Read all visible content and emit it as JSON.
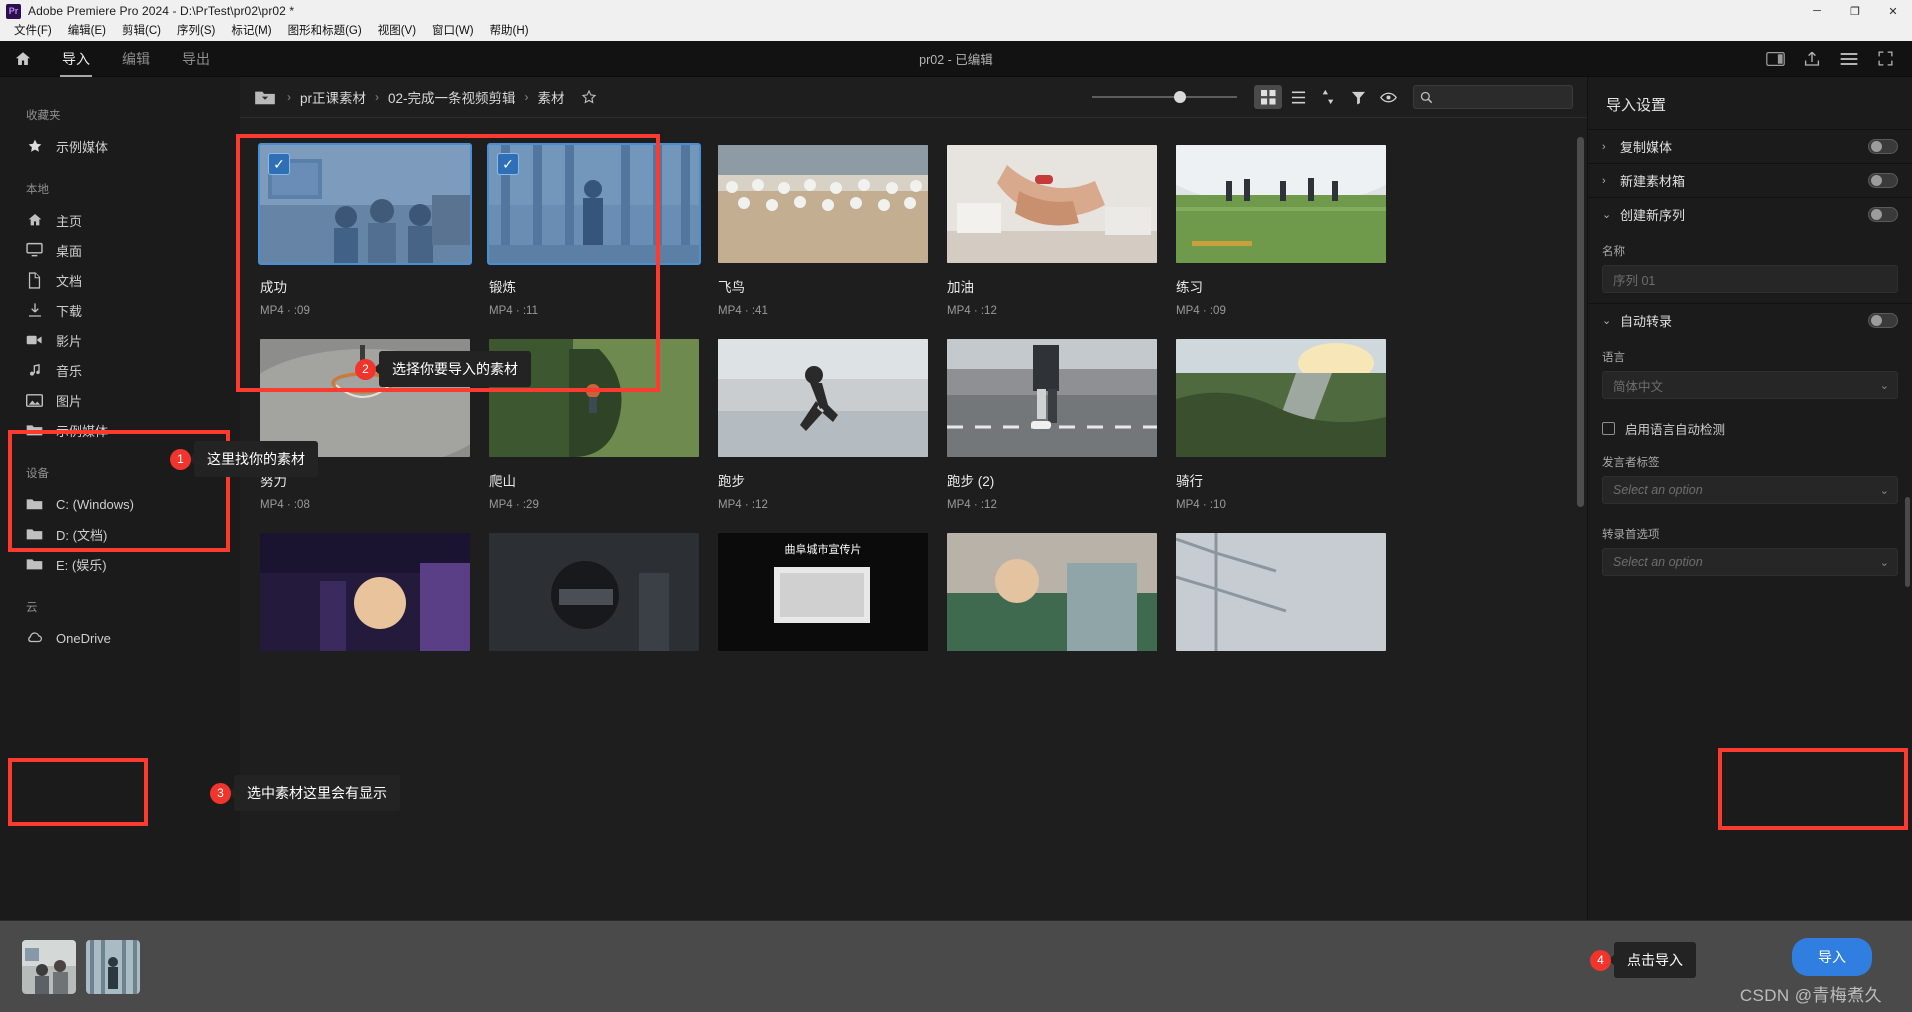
{
  "window": {
    "app_title": "Adobe Premiere Pro 2024 - D:\\PrTest\\pr02\\pr02 *",
    "logo_text": "Pr",
    "minimize": "─",
    "maximize": "❐",
    "close": "✕"
  },
  "menubar": {
    "items": [
      "文件(F)",
      "编辑(E)",
      "剪辑(C)",
      "序列(S)",
      "标记(M)",
      "图形和标题(G)",
      "视图(V)",
      "窗口(W)",
      "帮助(H)"
    ]
  },
  "workspace": {
    "home_icon": "home-icon",
    "tabs": [
      {
        "label": "导入",
        "active": true
      },
      {
        "label": "编辑",
        "active": false
      },
      {
        "label": "导出",
        "active": false
      }
    ],
    "project_title": "pr02 - 已编辑",
    "right_icons": [
      "panel-icon",
      "share-icon",
      "menu-icon",
      "fullscreen-icon"
    ]
  },
  "sidebar": {
    "groups": [
      {
        "title": "收藏夹",
        "items": [
          {
            "icon": "star-icon",
            "label": "示例媒体"
          }
        ]
      },
      {
        "title": "本地",
        "items": [
          {
            "icon": "home-icon",
            "label": "主页"
          },
          {
            "icon": "desktop-icon",
            "label": "桌面"
          },
          {
            "icon": "document-icon",
            "label": "文档"
          },
          {
            "icon": "download-icon",
            "label": "下载"
          },
          {
            "icon": "video-icon",
            "label": "影片"
          },
          {
            "icon": "music-icon",
            "label": "音乐"
          },
          {
            "icon": "image-icon",
            "label": "图片"
          },
          {
            "icon": "folder-icon",
            "label": "示例媒体"
          }
        ]
      },
      {
        "title": "设备",
        "items": [
          {
            "icon": "folder-icon",
            "label": "C: (Windows)"
          },
          {
            "icon": "folder-icon",
            "label": "D: (文档)"
          },
          {
            "icon": "folder-icon",
            "label": "E: (娱乐)"
          }
        ]
      },
      {
        "title": "云",
        "items": [
          {
            "icon": "cloud-icon",
            "label": "OneDrive"
          }
        ]
      }
    ]
  },
  "browser": {
    "breadcrumb": {
      "folder_icon": "folder-dropdown-icon",
      "parts": [
        "pr正课素材",
        "02-完成一条视频剪辑",
        "素材"
      ],
      "separator": "›",
      "star_icon": "star-outline-icon"
    },
    "toolbar": {
      "zoom_slider_value": 57,
      "grid_view_icon": "grid-view-icon",
      "list_view_icon": "list-view-icon",
      "sort_icon": "sort-icon",
      "filter_icon": "filter-icon",
      "eye_icon": "eye-icon",
      "search_icon": "search-icon",
      "search_value": "",
      "search_placeholder": ""
    },
    "items": [
      {
        "name": "成功",
        "meta": "MP4 · :09",
        "selected": true,
        "checked": true,
        "art": "office"
      },
      {
        "name": "锻炼",
        "meta": "MP4 · :11",
        "selected": true,
        "checked": true,
        "art": "hall"
      },
      {
        "name": "飞鸟",
        "meta": "MP4 · :41",
        "selected": false,
        "checked": false,
        "art": "birds"
      },
      {
        "name": "加油",
        "meta": "MP4 · :12",
        "selected": false,
        "checked": false,
        "art": "hands"
      },
      {
        "name": "练习",
        "meta": "MP4 · :09",
        "selected": false,
        "checked": false,
        "art": "field"
      },
      {
        "name": "努力",
        "meta": "MP4 · :08",
        "selected": false,
        "checked": false,
        "art": "hoop"
      },
      {
        "name": "爬山",
        "meta": "MP4 · :29",
        "selected": false,
        "checked": false,
        "art": "cliff"
      },
      {
        "name": "跑步",
        "meta": "MP4 · :12",
        "selected": false,
        "checked": false,
        "art": "runner"
      },
      {
        "name": "跑步 (2)",
        "meta": "MP4 · :12",
        "selected": false,
        "checked": false,
        "art": "prosthetic"
      },
      {
        "name": "骑行",
        "meta": "MP4 · :10",
        "selected": false,
        "checked": false,
        "art": "road"
      }
    ],
    "partial_row": [
      {
        "art": "concert"
      },
      {
        "art": "helmet"
      },
      {
        "art": "citytitle",
        "overlay_text": "曲阜城市宣传片"
      },
      {
        "art": "surgery"
      },
      {
        "art": "tower"
      }
    ]
  },
  "import_settings": {
    "title": "导入设置",
    "sections": [
      {
        "chev": "›",
        "label": "复制媒体",
        "toggle": "off"
      },
      {
        "chev": "›",
        "label": "新建素材箱",
        "toggle": "off"
      },
      {
        "chev": "⌄",
        "label": "创建新序列",
        "toggle": "off"
      }
    ],
    "sequence": {
      "name_label": "名称",
      "name_placeholder": "序列 01"
    },
    "transcription": {
      "chev": "⌄",
      "label": "自动转录",
      "toggle": "off",
      "language_label": "语言",
      "language_value": "简体中文",
      "auto_detect_label": "启用语言自动检测",
      "speaker_label": "发言者标签",
      "speaker_placeholder": "Select an option",
      "preference_label": "转录首选项",
      "preference_placeholder": "Select an option"
    }
  },
  "bottom": {
    "selected_thumbs": [
      "office",
      "hall"
    ],
    "import_button": "导入",
    "watermark": "CSDN @青梅煮久"
  },
  "annotations": [
    {
      "number": "1",
      "text": "这里找你的素材"
    },
    {
      "number": "2",
      "text": "选择你要导入的素材"
    },
    {
      "number": "3",
      "text": "选中素材这里会有显示"
    },
    {
      "number": "4",
      "text": "点击导入"
    }
  ],
  "colors": {
    "accent_blue": "#2f7ee0",
    "annotation_red": "#fd3a30",
    "selection_blue": "#4a8fd4",
    "panel_bg": "#1b1b1b"
  }
}
